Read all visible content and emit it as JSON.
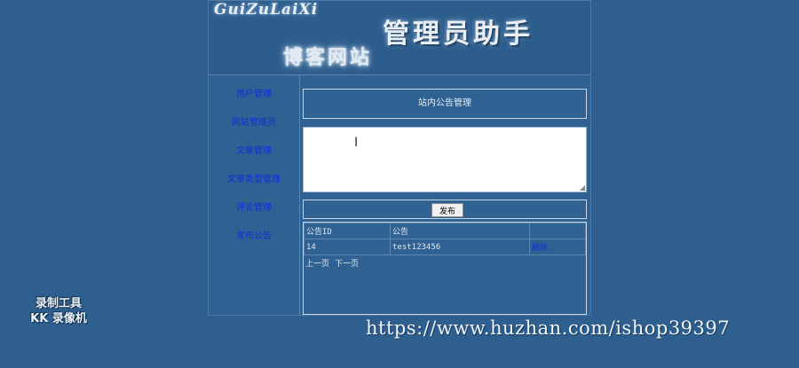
{
  "banner": {
    "brand_en": "GuiZuLaiXi",
    "title": "管理员助手",
    "subtitle": "博客网站"
  },
  "sidebar": {
    "items": [
      {
        "label": "用户管理"
      },
      {
        "label": "网站管理员"
      },
      {
        "label": "文章管理"
      },
      {
        "label": "文章类型管理"
      },
      {
        "label": "评论管理"
      },
      {
        "label": "发布公告"
      }
    ]
  },
  "content": {
    "heading": "站内公告管理",
    "editor_value": "",
    "publish_label": "发布",
    "table": {
      "headers": [
        "公告ID",
        "公告",
        ""
      ],
      "rows": [
        {
          "id": "14",
          "text": "test123456",
          "action": "删除"
        }
      ]
    },
    "pager": {
      "prev": "上一页",
      "next": "下一页"
    }
  },
  "overlay": {
    "tool_line1": "录制工具",
    "tool_line2": "KK 录像机",
    "url": "https://www.huzhan.com/ishop39397"
  },
  "colors": {
    "background": "#2e5f8f",
    "link": "#1030d8"
  }
}
